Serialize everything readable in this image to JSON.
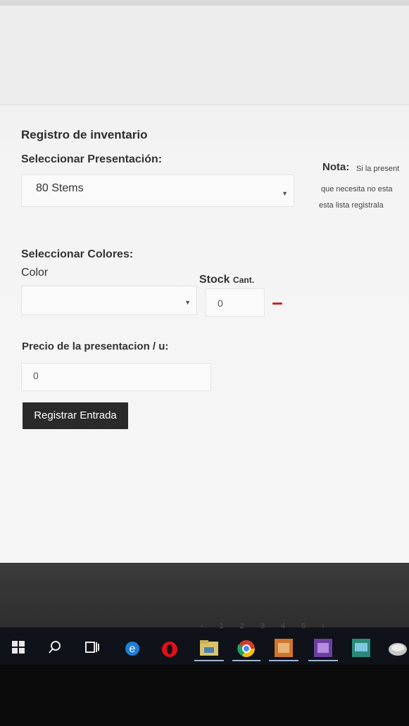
{
  "form": {
    "title": "Registro de inventario",
    "presentation_label": "Seleccionar Presentación:",
    "presentation_value": "80 Stems",
    "note_title": "Nota:",
    "note_line1": "Si la present",
    "note_line2": "que necesita no esta",
    "note_line3": "esta lista registrala",
    "colors_label": "Seleccionar Colores:",
    "color_label": "Color",
    "stock_label": "Stock",
    "stock_unit_label": "Cant.",
    "stock_value": "0",
    "price_label": "Precio de la presentacion / u:",
    "price_value": "0",
    "submit_label": "Registrar Entrada"
  },
  "footer": {
    "pagination": [
      "‹",
      "1",
      "2",
      "3",
      "4",
      "5",
      "›"
    ]
  },
  "taskbar": {
    "icons": [
      "windows-start-icon",
      "search-icon",
      "task-view-icon",
      "edge-icon",
      "opera-icon",
      "file-explorer-icon",
      "chrome-icon",
      "app-icon",
      "app-icon",
      "app-icon",
      "app-icon"
    ]
  },
  "colors": {
    "button_bg": "#2a2a2a",
    "remove_red": "#c62828",
    "taskbar_bg": "#0f1218"
  }
}
